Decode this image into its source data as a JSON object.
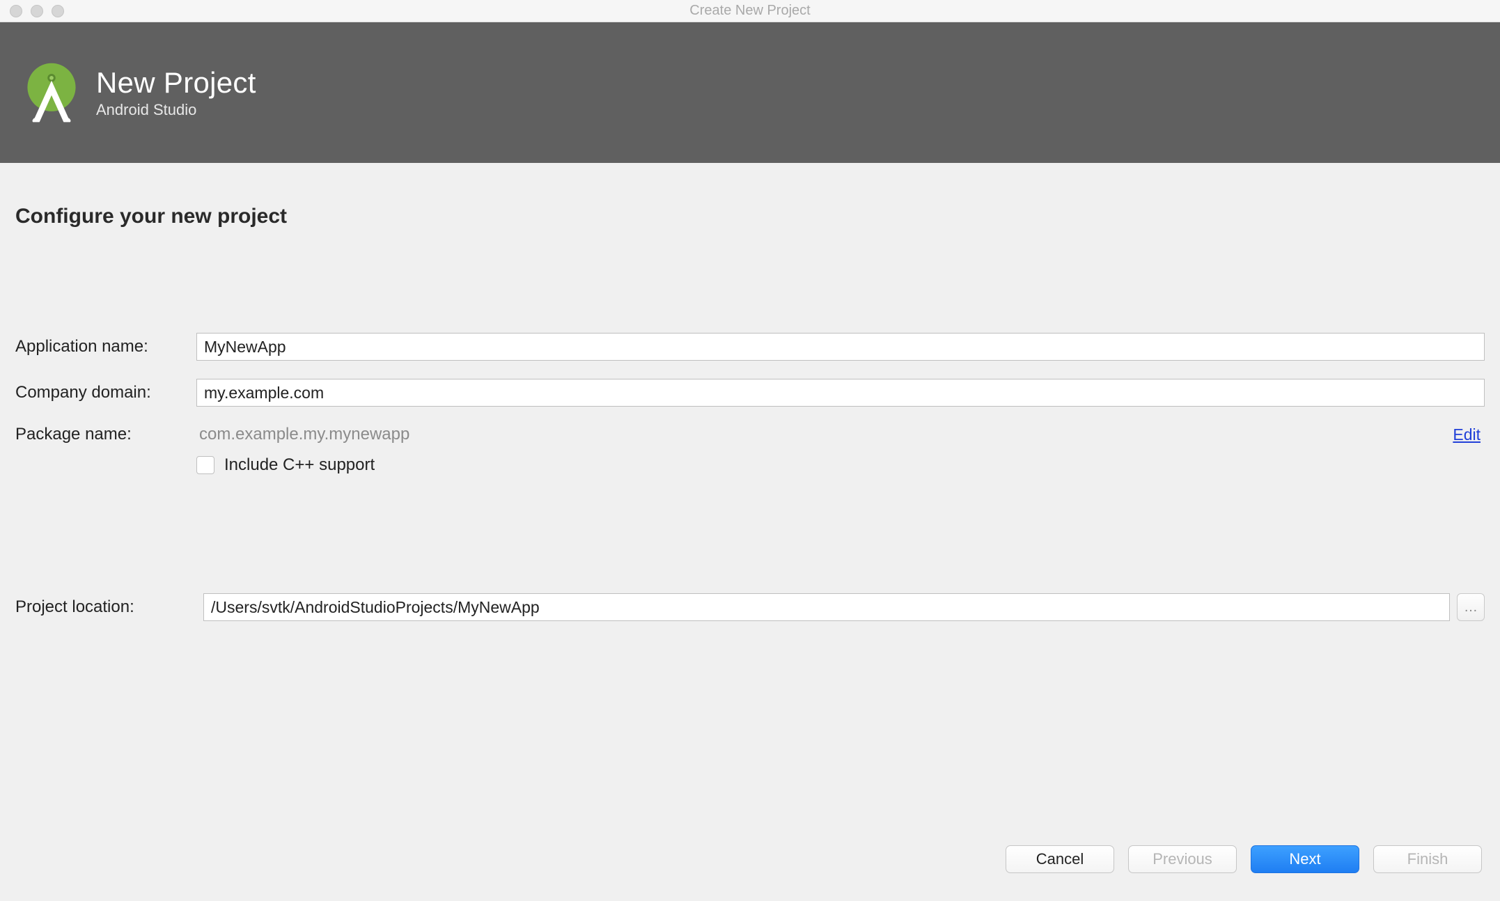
{
  "window": {
    "title": "Create New Project"
  },
  "header": {
    "title": "New Project",
    "subtitle": "Android Studio"
  },
  "section": {
    "title": "Configure your new project"
  },
  "form": {
    "app_name_label": "Application name:",
    "app_name_value": "MyNewApp",
    "company_label": "Company domain:",
    "company_value": "my.example.com",
    "package_label": "Package name:",
    "package_value": "com.example.my.mynewapp",
    "edit_label": "Edit",
    "cpp_label": "Include C++ support",
    "location_label": "Project location:",
    "location_value": "/Users/svtk/AndroidStudioProjects/MyNewApp",
    "browse_label": "…"
  },
  "buttons": {
    "cancel": "Cancel",
    "previous": "Previous",
    "next": "Next",
    "finish": "Finish"
  }
}
